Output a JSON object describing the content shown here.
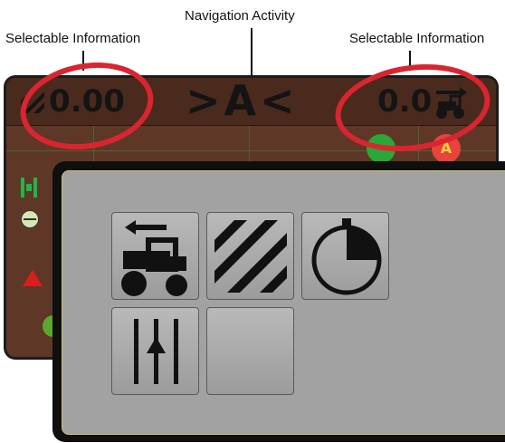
{
  "callouts": {
    "left": "Selectable Information",
    "center": "Navigation Activity",
    "right": "Selectable Information"
  },
  "guidance_screen": {
    "left_readout": "0.00",
    "navigation_activity": ">A<",
    "right_readout": "0.0",
    "indicator_letter": "A"
  },
  "colors": {
    "highlight_ellipse": "#d9252f",
    "screen_background": "#5e3727",
    "grid_lines": "#3f7a3a",
    "panel_background": "#a2a2a2"
  },
  "selection_panel": {
    "tiles": [
      {
        "icon": "vehicle-reverse-icon"
      },
      {
        "icon": "applied-area-icon"
      },
      {
        "icon": "timer-icon"
      },
      {
        "icon": "guideline-icon"
      },
      {
        "icon": "empty-slot"
      }
    ]
  }
}
